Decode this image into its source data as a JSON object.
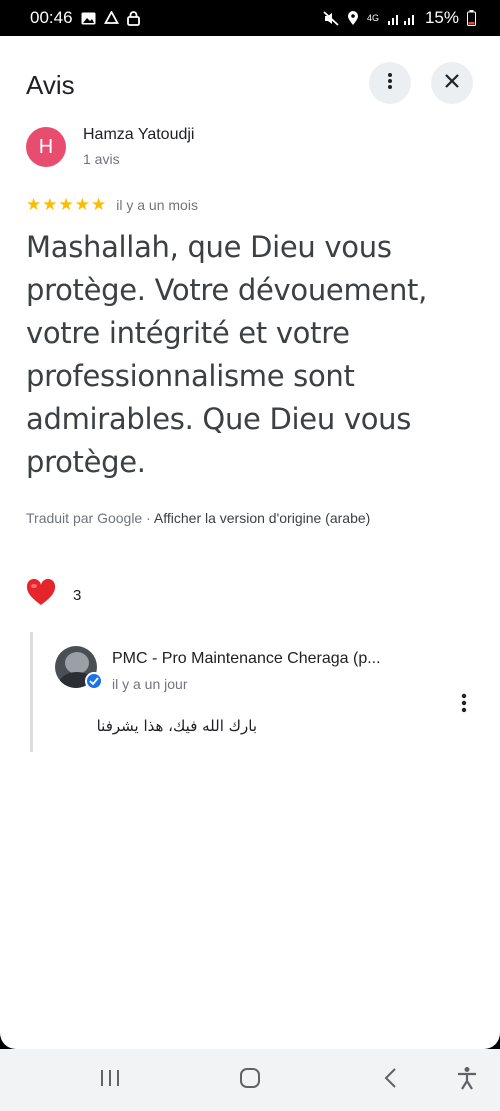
{
  "status_bar": {
    "time": "00:46",
    "network": "4G",
    "battery": "15%",
    "left_icons": [
      "gallery-icon",
      "recycle-icon",
      "lock-icon"
    ],
    "right_icons": [
      "mute-icon",
      "location-icon",
      "signal-icon",
      "battery-icon"
    ]
  },
  "header": {
    "title": "Avis",
    "more_icon": "more-vert-icon",
    "close_icon": "close-icon"
  },
  "review": {
    "avatar_letter": "H",
    "avatar_color": "#e84c6f",
    "author": "Hamza Yatoudji",
    "author_reviews": "1 avis",
    "stars": 5,
    "star_color": "#fbbc04",
    "time": "il y a un mois",
    "text": "Mashallah, que Dieu vous protège. Votre dévouement, votre intégrité et votre professionnalisme sont admirables. Que Dieu vous protège.",
    "translated_by": "Traduit par Google · ",
    "view_original": "Afficher la version d'origine (arabe)",
    "reaction_icon": "heart-icon",
    "reaction_count": "3"
  },
  "owner_reply": {
    "name": "PMC - Pro Maintenance Cheraga (p...",
    "time": "il y a un jour",
    "text": "بارك الله فيك، هذا يشرفنا",
    "verified_icon": "verified-check-icon",
    "verified_color": "#1a73e8"
  },
  "nav_bar": {
    "icons": [
      "recent-apps-icon",
      "home-icon",
      "back-icon",
      "accessibility-icon"
    ]
  }
}
